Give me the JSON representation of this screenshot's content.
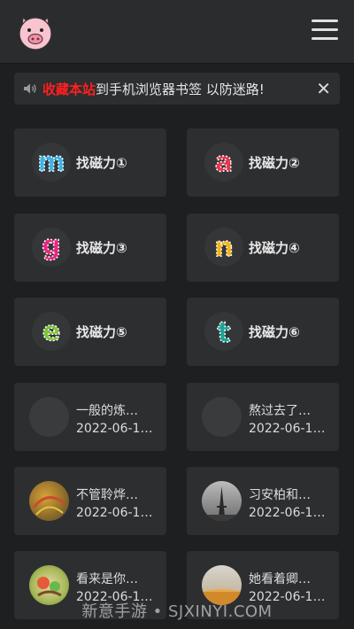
{
  "notice": {
    "highlight": "收藏本站",
    "text": "到手机浏览器书签 以防迷路!",
    "close": "✕"
  },
  "nav_cards": [
    {
      "title": "找磁力①",
      "letter": "m",
      "color": "#3cb4e6"
    },
    {
      "title": "找磁力②",
      "letter": "a",
      "color": "#e8344e"
    },
    {
      "title": "找磁力③",
      "letter": "g",
      "color": "#e6267e"
    },
    {
      "title": "找磁力④",
      "letter": "n",
      "color": "#f2b418"
    },
    {
      "title": "找磁力⑤",
      "letter": "e",
      "color": "#7cc23a"
    },
    {
      "title": "找磁力⑥",
      "letter": "t",
      "color": "#1fa394"
    }
  ],
  "posts": [
    {
      "title": "一般的炼…",
      "date": "2022-06-1…"
    },
    {
      "title": "熬过去了…",
      "date": "2022-06-1…"
    },
    {
      "title": "不管聆烨…",
      "date": "2022-06-1…"
    },
    {
      "title": "习安柏和…",
      "date": "2022-06-1…"
    },
    {
      "title": "看来是你…",
      "date": "2022-06-1…"
    },
    {
      "title": "她看着卿…",
      "date": "2022-06-1…"
    }
  ],
  "watermark": "新意手游 • SJXINYI.COM",
  "icons": {
    "logo": "pig-logo-icon",
    "menu": "hamburger-menu-icon",
    "speaker": "speaker-icon"
  }
}
